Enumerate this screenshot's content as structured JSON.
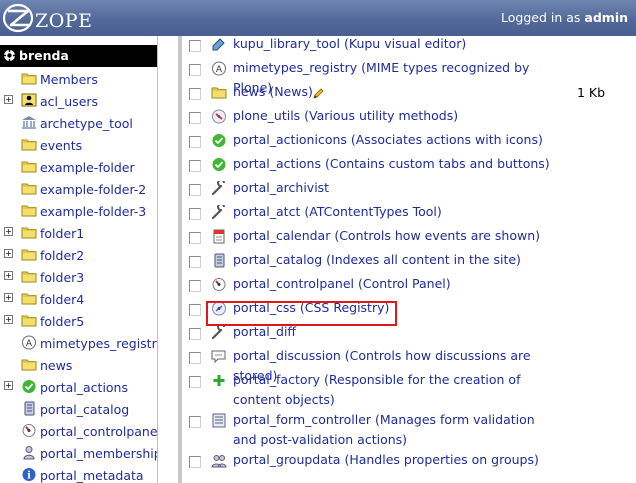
{
  "header": {
    "logo_text": "ZOPE",
    "login_prefix": "Logged in as",
    "login_user": "admin"
  },
  "tree": {
    "root": "brenda",
    "items": [
      {
        "label": "Members",
        "icon": "folder-icon",
        "expandable": false
      },
      {
        "label": "acl_users",
        "icon": "user-folder-icon",
        "expandable": true
      },
      {
        "label": "archetype_tool",
        "icon": "archetype-tool-icon",
        "expandable": false
      },
      {
        "label": "events",
        "icon": "folder-icon",
        "expandable": false
      },
      {
        "label": "example-folder",
        "icon": "folder-icon",
        "expandable": false
      },
      {
        "label": "example-folder-2",
        "icon": "folder-icon",
        "expandable": false
      },
      {
        "label": "example-folder-3",
        "icon": "folder-icon",
        "expandable": false
      },
      {
        "label": "folder1",
        "icon": "folder-icon",
        "expandable": true
      },
      {
        "label": "folder2",
        "icon": "folder-icon",
        "expandable": true
      },
      {
        "label": "folder3",
        "icon": "folder-icon",
        "expandable": true
      },
      {
        "label": "folder4",
        "icon": "folder-icon",
        "expandable": true
      },
      {
        "label": "folder5",
        "icon": "folder-icon",
        "expandable": true
      },
      {
        "label": "mimetypes_registry",
        "icon": "mimetypes-icon",
        "expandable": false
      },
      {
        "label": "news",
        "icon": "folder-icon",
        "expandable": false
      },
      {
        "label": "portal_actions",
        "icon": "check-icon",
        "expandable": true
      },
      {
        "label": "portal_catalog",
        "icon": "catalog-icon",
        "expandable": false
      },
      {
        "label": "portal_controlpanel",
        "icon": "controlpanel-icon",
        "expandable": false
      },
      {
        "label": "portal_membership",
        "icon": "membership-icon",
        "expandable": false
      },
      {
        "label": "portal_metadata",
        "icon": "info-icon",
        "expandable": false
      }
    ]
  },
  "list": {
    "rows": [
      {
        "text": "kupu_library_tool (Kupu visual editor)",
        "icon": "kupu-icon",
        "size": ""
      },
      {
        "text": "mimetypes_registry (MIME types recognized by Plone)",
        "icon": "mimetypes-icon",
        "size": ""
      },
      {
        "text": "news (News)",
        "icon": "folder-icon",
        "size": "1 Kb"
      },
      {
        "text": "plone_utils (Various utility methods)",
        "icon": "utils-icon",
        "size": ""
      },
      {
        "text": "portal_actionicons (Associates actions with icons)",
        "icon": "check-icon",
        "size": ""
      },
      {
        "text": "portal_actions (Contains custom tabs and buttons)",
        "icon": "check-icon",
        "size": ""
      },
      {
        "text": "portal_archivist",
        "icon": "wrench-icon",
        "size": ""
      },
      {
        "text": "portal_atct (ATContentTypes Tool)",
        "icon": "wrench-icon",
        "size": ""
      },
      {
        "text": "portal_calendar (Controls how events are shown)",
        "icon": "calendar-icon",
        "size": ""
      },
      {
        "text": "portal_catalog (Indexes all content in the site)",
        "icon": "catalog-icon",
        "size": ""
      },
      {
        "text": "portal_controlpanel (Control Panel)",
        "icon": "controlpanel-icon",
        "size": ""
      },
      {
        "text": "portal_css (CSS Registry)",
        "icon": "css-registry-icon",
        "size": ""
      },
      {
        "text": "portal_diff",
        "icon": "wrench-icon",
        "size": ""
      },
      {
        "text": "portal_discussion (Controls how discussions are stored)",
        "icon": "discussion-icon",
        "size": ""
      },
      {
        "text": "portal_factory (Responsible for the creation of content objects)",
        "icon": "factory-plus-icon",
        "size": ""
      },
      {
        "text": "portal_form_controller (Manages form validation and post-validation actions)",
        "icon": "form-controller-icon",
        "size": ""
      },
      {
        "text": "portal_groupdata (Handles properties on groups)",
        "icon": "groupdata-icon",
        "size": ""
      }
    ]
  },
  "colors": {
    "link": "#1f2c9c",
    "header_bg": "#53699a",
    "highlight_border": "#e01818",
    "tree_selected_bg": "#000000"
  }
}
